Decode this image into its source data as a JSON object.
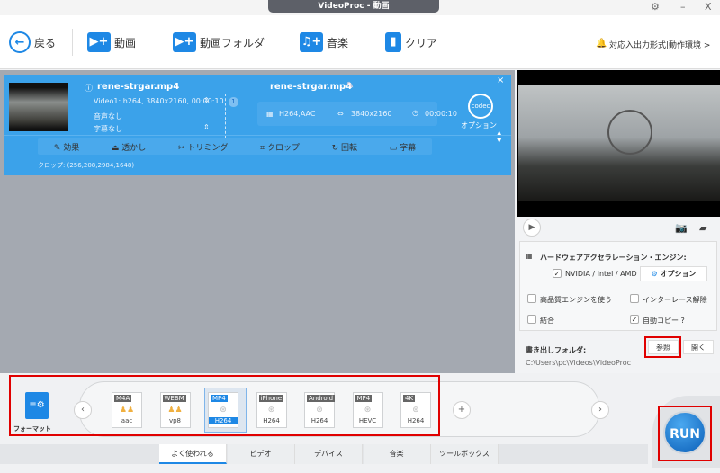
{
  "window": {
    "title": "VideoProc - 動画",
    "settings_icon": "gear-icon",
    "minimize": "–",
    "close": "X"
  },
  "toolbar": {
    "back": "戻る",
    "video": "動画",
    "video_folder": "動画フォルダ",
    "music": "音楽",
    "clear": "クリア",
    "notice": "対応入出力形式|動作環境 >"
  },
  "item": {
    "src_name": "rene-strgar.mp4",
    "video_track": "Video1: h264, 3840x2160, 00:00:10",
    "audio": "音声なし",
    "subtitle": "字幕なし",
    "track_count": "1",
    "out_name": "rene-strgar.mp4",
    "codec": "H264,AAC",
    "resolution": "3840x2160",
    "duration": "00:00:10",
    "codec_label": "codec",
    "option": "オプション",
    "crop_info": "クロップ: (256,208,2984,1648)"
  },
  "actions": [
    "効果",
    "透かし",
    "トリミング",
    "クロップ",
    "回転",
    "字幕"
  ],
  "settings": {
    "hw_title": "ハードウェアアクセラレーション・エンジン:",
    "nvidia": "NVIDIA / Intel / AMD",
    "option": "オプション",
    "hq": "高品質エンジンを使う",
    "deinterlace": "インターレース解除",
    "merge": "結合",
    "autocopy": "自動コピー ?",
    "output_label": "書き出しフォルダ:",
    "browse": "参照",
    "open": "開く",
    "output_path": "C:\\Users\\pc\\Videos\\VideoProc"
  },
  "formats": {
    "label": "フォーマット",
    "items": [
      {
        "top": "M4A",
        "bottom": "aac"
      },
      {
        "top": "WEBM",
        "bottom": "vp8"
      },
      {
        "top": "MP4",
        "bottom": "H264"
      },
      {
        "top": "iPhone",
        "bottom": "H264"
      },
      {
        "top": "Android",
        "bottom": "H264"
      },
      {
        "top": "MP4",
        "bottom": "HEVC"
      },
      {
        "top": "4K",
        "bottom": "H264"
      }
    ],
    "selected": 2
  },
  "tabs": [
    "よく使われる",
    "ビデオ",
    "デバイス",
    "音楽",
    "ツールボックス"
  ],
  "run": "RUN"
}
